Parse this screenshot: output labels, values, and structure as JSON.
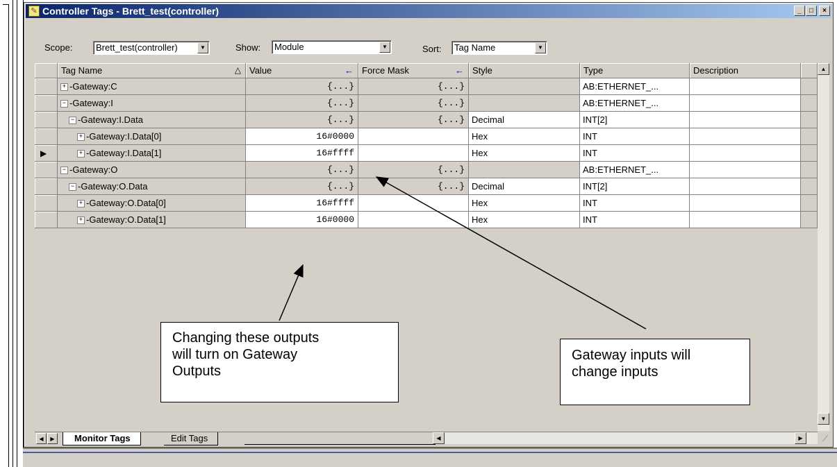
{
  "window": {
    "title": "Controller Tags - Brett_test(controller)",
    "buttons": {
      "minimize": "_",
      "maximize": "□",
      "close": "×"
    }
  },
  "toolbar": {
    "scope_label": "Scope:",
    "scope_value": "Brett_test(controller)",
    "show_label": "Show:",
    "show_value": "Module",
    "sort_label": "Sort:",
    "sort_value": "Tag Name"
  },
  "grid": {
    "headers": {
      "tag_name": "Tag Name",
      "sort_indicator": "△",
      "value": "Value",
      "force_mask": "Force Mask",
      "style": "Style",
      "type": "Type",
      "description": "Description"
    },
    "rows": [
      {
        "expander": "+",
        "tag": "-Gateway:C",
        "value": "{...}",
        "force_mask": "{...}",
        "style": "",
        "type": "AB:ETHERNET_...",
        "description": ""
      },
      {
        "expander": "−",
        "tag": "-Gateway:I",
        "value": "{...}",
        "force_mask": "{...}",
        "style": "",
        "type": "AB:ETHERNET_...",
        "description": ""
      },
      {
        "expander": "−",
        "tag": "-Gateway:I.Data",
        "value": "{...}",
        "force_mask": "{...}",
        "style": "Decimal",
        "type": "INT[2]",
        "description": ""
      },
      {
        "expander": "+",
        "tag": "-Gateway:I.Data[0]",
        "value": "16#0000",
        "force_mask": "",
        "style": "Hex",
        "type": "INT",
        "description": ""
      },
      {
        "expander": "+",
        "tag": "-Gateway:I.Data[1]",
        "value": "16#ffff",
        "force_mask": "",
        "style": "Hex",
        "type": "INT",
        "description": ""
      },
      {
        "expander": "−",
        "tag": "-Gateway:O",
        "value": "{...}",
        "force_mask": "{...}",
        "style": "",
        "type": "AB:ETHERNET_...",
        "description": ""
      },
      {
        "expander": "−",
        "tag": "-Gateway:O.Data",
        "value": "{...}",
        "force_mask": "{...}",
        "style": "Decimal",
        "type": "INT[2]",
        "description": ""
      },
      {
        "expander": "+",
        "tag": "-Gateway:O.Data[0]",
        "value": "16#ffff",
        "force_mask": "",
        "style": "Hex",
        "type": "INT",
        "description": ""
      },
      {
        "expander": "+",
        "tag": "-Gateway:O.Data[1]",
        "value": "16#0000",
        "force_mask": "",
        "style": "Hex",
        "type": "INT",
        "description": ""
      }
    ],
    "current_row_marker": "▶"
  },
  "tabs": {
    "monitor": "Monitor Tags",
    "edit": "Edit Tags"
  },
  "annotations": {
    "outputs_note": "Changing these outputs\nwill turn on Gateway\nOutputs",
    "inputs_note": "Gateway inputs will\nchange inputs"
  }
}
